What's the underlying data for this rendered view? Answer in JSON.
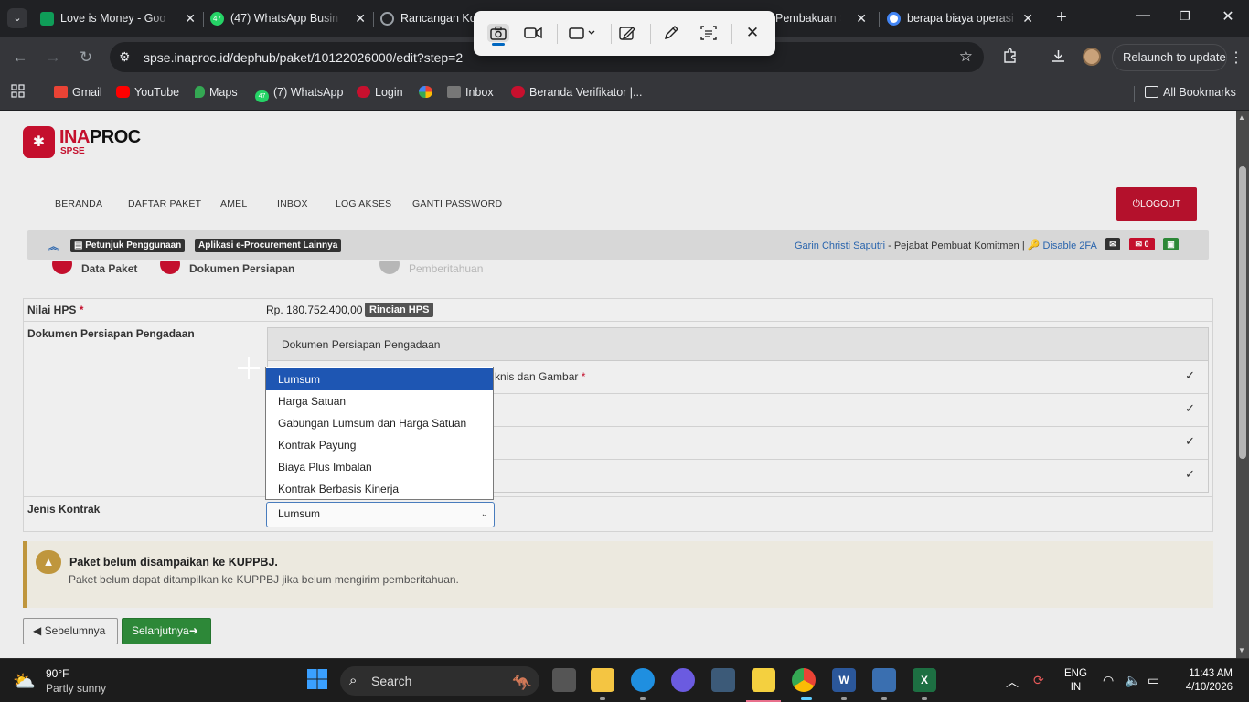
{
  "browser": {
    "tabs": [
      {
        "title": "Love is Money - Goo",
        "color": "#0f9d58"
      },
      {
        "title": "(47) WhatsApp Busin",
        "color": "#25d366"
      },
      {
        "title": "Rancangan Ko",
        "color": "#5f6368"
      },
      {
        "title": "Pembakuan S",
        "color": "#5f6368"
      },
      {
        "title": "berapa biaya operasi",
        "color": "#4285f4"
      }
    ],
    "whatsapp_badge": "47",
    "url": "spse.inaproc.id/dephub/paket/10122026000/edit?step=2",
    "relaunch_label": "Relaunch to update",
    "bookmarks": [
      {
        "label": "Gmail",
        "color": "#ea4335"
      },
      {
        "label": "YouTube",
        "color": "#ff0000"
      },
      {
        "label": "Maps",
        "color": "#34a853"
      },
      {
        "label": "(7) WhatsApp",
        "color": "#25d366"
      },
      {
        "label": "Login",
        "color": "#c8102e"
      },
      {
        "label": "",
        "color": "#fbbc05"
      },
      {
        "label": "Inbox",
        "color": "#777777"
      },
      {
        "label": "Beranda Verifikator |...",
        "color": "#c8102e"
      }
    ],
    "whatsapp_bookmark_badge": "47",
    "all_bookmarks_label": "All Bookmarks"
  },
  "snipping_tool": {
    "buttons": [
      "camera-icon",
      "video-icon",
      "rectangle-mode-icon",
      "edit-icon",
      "pen-icon",
      "text-extract-icon",
      "close-icon"
    ]
  },
  "app": {
    "logo_ina": "INA",
    "logo_proc": "PROC",
    "logo_sub": "SPSE",
    "nav": [
      "BERANDA",
      "DAFTAR PAKET",
      "AMEL",
      "INBOX",
      "LOG AKSES",
      "GANTI PASSWORD"
    ],
    "logout_label": "LOGOUT",
    "info": {
      "tag_petunjuk": "Petunjuk Penggunaan",
      "tag_aplikasi": "Aplikasi e-Procurement Lainnya",
      "user_name": "Garin Christi Saputri",
      "user_role": " - Pejabat Pembuat Komitmen | ",
      "disable_2fa": "Disable 2FA",
      "inbox_count": "0",
      "colors": {
        "red": "#c8102e",
        "green": "#2e8b3a",
        "dark": "#333333"
      }
    },
    "steps": [
      {
        "num": "1",
        "label": "Data Paket",
        "color": "#c8102e"
      },
      {
        "num": "2",
        "label": "Dokumen Persiapan",
        "color": "#c8102e"
      },
      {
        "num": "3",
        "label": "Pemberitahuan",
        "color": "#bbbbbb"
      }
    ]
  },
  "form": {
    "hps_label": "Nilai HPS",
    "hps_value": "Rp. 180.752.400,00",
    "rincian_label": "Rincian HPS",
    "dokumen_label": "Dokumen Persiapan Pengadaan",
    "dokumen_panel_title": "Dokumen Persiapan Pengadaan",
    "dokumen_rows": [
      {
        "text": "knis dan Gambar",
        "required": true
      },
      {
        "text": "",
        "required": false
      },
      {
        "text": "",
        "required": false
      },
      {
        "text": "",
        "required": false
      }
    ],
    "jenis_kontrak_label": "Jenis Kontrak",
    "jenis_kontrak_value": "Lumsum",
    "jenis_kontrak_options": [
      "Lumsum",
      "Harga Satuan",
      "Gabungan Lumsum dan Harga Satuan",
      "Kontrak Payung",
      "Biaya Plus Imbalan",
      "Kontrak Berbasis Kinerja"
    ],
    "selected_option_index": 0
  },
  "alert": {
    "title": "Paket belum disampaikan ke KUPPBJ.",
    "desc": "Paket belum dapat ditampilkan ke KUPPBJ jika belum mengirim pemberitahuan."
  },
  "buttons": {
    "prev": "Sebelumnya",
    "next": "Selanjutnya"
  },
  "taskbar": {
    "temp": "90°F",
    "weather": "Partly sunny",
    "search_placeholder": "Search",
    "lang_top": "ENG",
    "lang_bottom": "IN",
    "time": "11:43 AM",
    "date": "4/10/2026"
  }
}
